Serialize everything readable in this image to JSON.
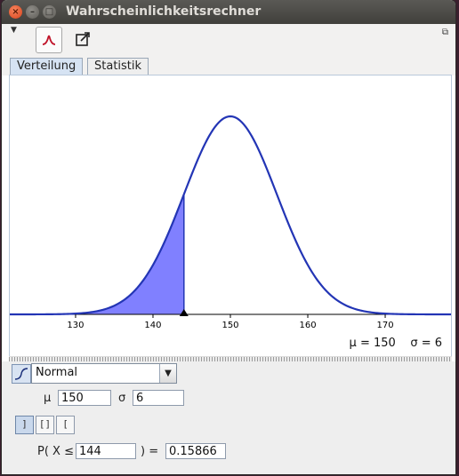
{
  "window": {
    "title": "Wahrscheinlichkeitsrechner"
  },
  "tabs": [
    {
      "label": "Verteilung",
      "active": true
    },
    {
      "label": "Statistik",
      "active": false
    }
  ],
  "toolbar": {
    "icons": [
      "distribution-icon",
      "export-icon"
    ]
  },
  "chart_data": {
    "type": "line",
    "title": "",
    "distribution": "normal",
    "mu": 150,
    "sigma": 6,
    "xlim": [
      121.5,
      178.5
    ],
    "x_ticks": [
      130,
      140,
      150,
      160,
      170
    ],
    "shaded_region": {
      "from": 121.5,
      "to": 144
    },
    "marker_x": 144,
    "curve_color": "#2335b5",
    "fill_color": "#8080ff"
  },
  "params_label": {
    "mu": "μ = 150",
    "sigma": "σ = 6"
  },
  "controls": {
    "distribution_value": "Normal",
    "mu_label": "μ",
    "mu_value": "150",
    "sigma_label": "σ",
    "sigma_value": "6",
    "prob_prefix": "P( X ≤",
    "bound_value": "144",
    "prob_mid": ") =",
    "result_value": "0.15866"
  }
}
